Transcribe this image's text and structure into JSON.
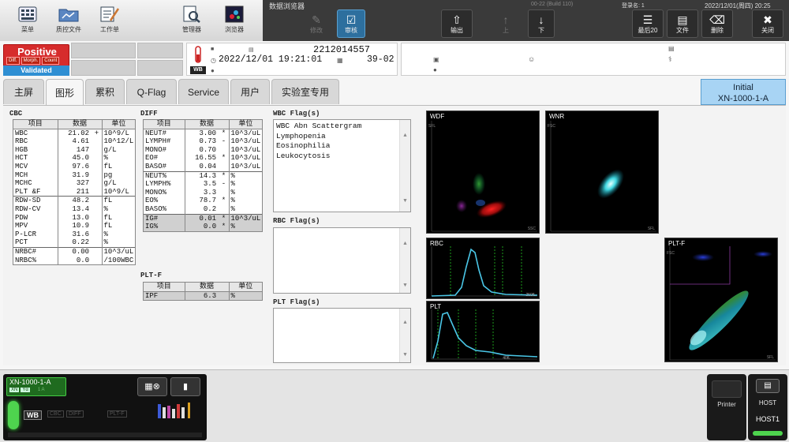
{
  "toolbar": {
    "menu": "菜单",
    "qc_file": "质控文件",
    "worklist": "工作单",
    "manager": "管理器",
    "browser": "浏览器"
  },
  "darkbar": {
    "title": "数据浏览器",
    "build": "00-22 (Build 110)",
    "login": "登录名: 1",
    "datetime": "2022/12/01(周四) 20:25",
    "buttons": {
      "modify": "修改",
      "review": "审核",
      "output": "输出",
      "up": "上",
      "down": "下",
      "last20": "最后20",
      "file": "文件",
      "delete": "删除",
      "close": "关闭"
    }
  },
  "status": {
    "positive": "Positive",
    "chips": [
      "Diff.",
      "Morph.",
      "Count"
    ],
    "validated": "Validated"
  },
  "sample": {
    "id": "2212014557",
    "datetime": "2022/12/01 19:21:01",
    "rack_pos": "39-02",
    "tube_label": "WB"
  },
  "tabs": [
    "主屏",
    "图形",
    "累积",
    "Q-Flag",
    "Service",
    "用户",
    "实验室专用"
  ],
  "analyzer_initial": {
    "line1": "Initial",
    "line2": "XN-1000-1-A"
  },
  "cbc": {
    "title": "CBC",
    "headers": [
      "项目",
      "数据",
      "单位"
    ],
    "rows": [
      [
        "WBC",
        "21.02",
        "+",
        "10^9/L"
      ],
      [
        "RBC",
        "4.61",
        "",
        "10^12/L"
      ],
      [
        "HGB",
        "147",
        "",
        "g/L"
      ],
      [
        "HCT",
        "45.0",
        "",
        "%"
      ],
      [
        "MCV",
        "97.6",
        "",
        "fL"
      ],
      [
        "MCH",
        "31.9",
        "",
        "pg"
      ],
      [
        "MCHC",
        "327",
        "",
        "g/L"
      ],
      [
        "PLT &F",
        "211",
        "",
        "10^9/L"
      ],
      [
        "RDW-SD",
        "48.2",
        "",
        "fL"
      ],
      [
        "RDW-CV",
        "13.4",
        "",
        "%"
      ],
      [
        "PDW",
        "13.0",
        "",
        "fL"
      ],
      [
        "MPV",
        "10.9",
        "",
        "fL"
      ],
      [
        "P-LCR",
        "31.6",
        "",
        "%"
      ],
      [
        "PCT",
        "0.22",
        "",
        "%"
      ],
      [
        "NRBC#",
        "0.00",
        "",
        "10^3/uL"
      ],
      [
        "NRBC%",
        "0.0",
        "",
        "/100WBC"
      ]
    ]
  },
  "diff": {
    "title": "DIFF",
    "headers": [
      "项目",
      "数据",
      "单位"
    ],
    "rows": [
      [
        "NEUT#",
        "3.00",
        "*",
        "10^3/uL"
      ],
      [
        "LYMPH#",
        "0.73",
        "-",
        "10^3/uL"
      ],
      [
        "MONO#",
        "0.70",
        "",
        "10^3/uL"
      ],
      [
        "EO#",
        "16.55",
        "*",
        "10^3/uL"
      ],
      [
        "BASO#",
        "0.04",
        "",
        "10^3/uL"
      ],
      [
        "NEUT%",
        "14.3",
        "*",
        "%"
      ],
      [
        "LYMPH%",
        "3.5",
        "-",
        "%"
      ],
      [
        "MONO%",
        "3.3",
        "",
        "%"
      ],
      [
        "EO%",
        "78.7",
        "*",
        "%"
      ],
      [
        "BASO%",
        "0.2",
        "",
        "%"
      ],
      [
        "IG#",
        "0.01",
        "*",
        "10^3/uL"
      ],
      [
        "IG%",
        "0.0",
        "*",
        "%"
      ]
    ]
  },
  "pltf": {
    "title": "PLT-F",
    "headers": [
      "项目",
      "数据",
      "单位"
    ],
    "rows": [
      [
        "IPF",
        "6.3",
        "",
        "%"
      ]
    ]
  },
  "flags": {
    "wbc_title": "WBC Flag(s)",
    "wbc_items": [
      "WBC Abn Scattergram",
      "Lymphopenia",
      "Eosinophilia",
      "Leukocytosis"
    ],
    "rbc_title": "RBC Flag(s)",
    "plt_title": "PLT Flag(s)"
  },
  "graphs": {
    "wdf": "WDF",
    "wdf_x": "SSC",
    "wdf_y": "SFL",
    "wnr": "WNR",
    "wnr_x": "SFL",
    "wnr_y": "FSC",
    "rbc": "RBC",
    "rbc_x": "250fL",
    "plt": "PLT",
    "plt_x": "40fL",
    "pltf": "PLT-F",
    "pltf_x": "SFL",
    "pltf_y": "FSC"
  },
  "bottom": {
    "analyzer_name": "XN-1000-1-A",
    "mode_chips": [
      "XN",
      "Yα"
    ],
    "mode_right": "1 A",
    "wb": "WB",
    "cbc": "CBC",
    "diff": "DIFF",
    "pltf": "PLT-F",
    "printer": "Printer",
    "host": "HOST",
    "host1": "HOST1"
  }
}
